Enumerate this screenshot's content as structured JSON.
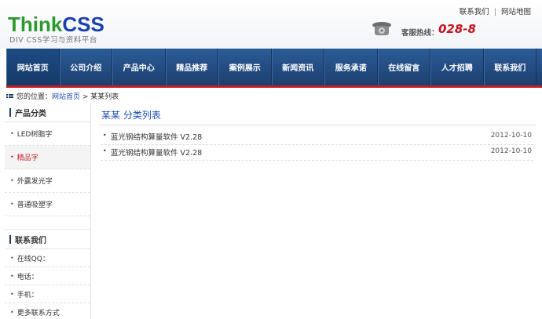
{
  "header": {
    "logo_think": "Think",
    "logo_css": "CSS",
    "logo_sub": "DIV CSS学习与资料平台",
    "top_links": [
      "联系我们",
      "网站地图"
    ],
    "top_links_sep": "|",
    "hotline_label": "客服热线：",
    "hotline_number": "028-8"
  },
  "nav": {
    "items": [
      "网站首页",
      "公司介绍",
      "产品中心",
      "精品推荐",
      "案例展示",
      "新闻资讯",
      "服务承诺",
      "在线留言",
      "人才招聘",
      "联系我们"
    ]
  },
  "breadcrumb": {
    "prefix": "您的位置：",
    "home": "网站首页",
    "sep": " > ",
    "current": "某某列表"
  },
  "sidebar": {
    "category_title": "产品分类",
    "categories": [
      "LED树脂字",
      "精品字",
      "外露发光字",
      "普通吸塑字"
    ],
    "contact_title": "联系我们",
    "contacts": [
      "在线QQ：",
      "电话：",
      "手机：",
      "更多联系方式"
    ]
  },
  "main": {
    "title": "某某 分类列表",
    "articles": [
      {
        "title": "蓝光钢结构算量软件 V2.28",
        "date": "2012-10-10"
      },
      {
        "title": "蓝光钢结构算量软件 V2.28",
        "date": "2012-10-10"
      }
    ]
  },
  "colors": {
    "nav_bg": "#1d3f6f",
    "nav_accent": "#c21f24",
    "link": "#1a4fb0",
    "logo_green": "#2e9a2e",
    "logo_blue": "#1a3fb0",
    "hotline_red": "#c4111b"
  },
  "icons": {
    "phone": "telephone-icon",
    "breadcrumb": "grid-icon"
  }
}
